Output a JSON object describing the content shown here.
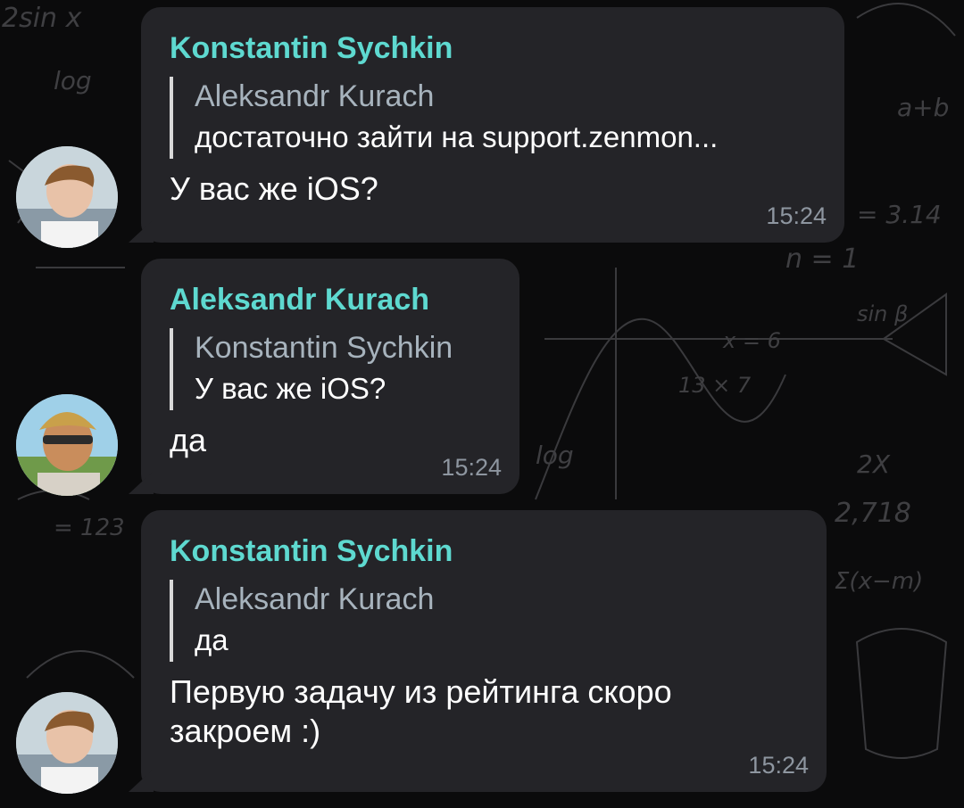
{
  "chat": {
    "messages": [
      {
        "sender": "Konstantin Sychkin",
        "reply_to": {
          "name": "Aleksandr Kurach",
          "text": "достаточно зайти на support.zenmon..."
        },
        "text": "У вас же iOS?",
        "time": "15:24"
      },
      {
        "sender": "Aleksandr Kurach",
        "reply_to": {
          "name": "Konstantin Sychkin",
          "text": "У вас же iOS?"
        },
        "text": "да",
        "time": "15:24"
      },
      {
        "sender": "Konstantin Sychkin",
        "reply_to": {
          "name": "Aleksandr Kurach",
          "text": "да"
        },
        "text": "Первую задачу из рейтинга скоро закроем :)",
        "time": "15:24"
      }
    ]
  },
  "background": {
    "formulas": [
      "2sin x",
      "log",
      "= 3.14",
      "n = 1",
      "2,718",
      "Σ(x−m)",
      "2X",
      "13 × 7",
      "sin β",
      "x = 6",
      "log",
      "a+b",
      "= 123"
    ]
  },
  "colors": {
    "sender": "#5ed9d0",
    "bubble": "#242428",
    "time": "#8e96a0",
    "reply_bar": "#d8d8d8"
  }
}
